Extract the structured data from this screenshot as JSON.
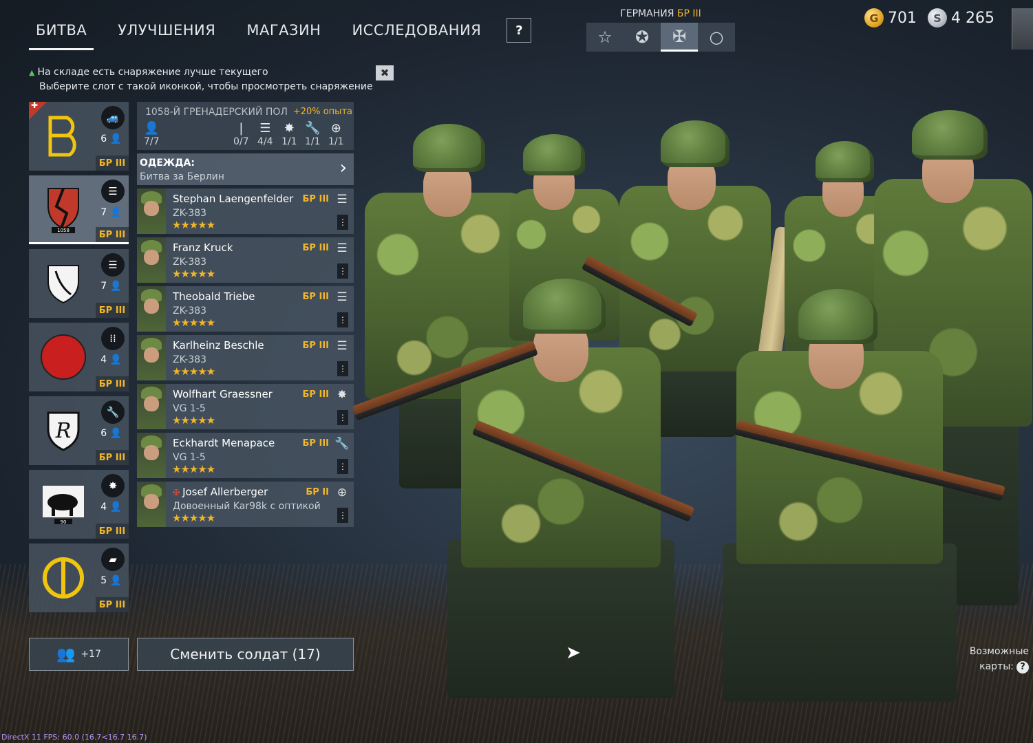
{
  "nav": {
    "tabs": [
      "БИТВА",
      "УЛУЧШЕНИЯ",
      "МАГАЗИН",
      "ИССЛЕДОВАНИЯ"
    ],
    "active_tab": 0,
    "help": "?"
  },
  "nation": {
    "title": "ГЕРМАНИЯ",
    "br": "БР III",
    "tabs": [
      "☆",
      "✪",
      "✠",
      "○"
    ],
    "active": 2
  },
  "currency": {
    "gold": "701",
    "silver": "4 265",
    "gold_icon": "G",
    "silver_icon": "S"
  },
  "notice": {
    "line1": "На складе есть снаряжение лучше текущего",
    "line2": "Выберите слот с такой иконкой, чтобы просмотреть снаряжение",
    "close": "✖"
  },
  "squads": [
    {
      "count": "6",
      "br": "БР III",
      "type_icon": "jeep-icon",
      "emblem": "B"
    },
    {
      "count": "7",
      "br": "БР III",
      "type_icon": "radio-icon",
      "emblem": "1058"
    },
    {
      "count": "7",
      "br": "БР III",
      "type_icon": "radio-icon",
      "emblem": "sword"
    },
    {
      "count": "4",
      "br": "БР III",
      "type_icon": "ammo-icon",
      "emblem": "circle"
    },
    {
      "count": "6",
      "br": "БР III",
      "type_icon": "wrench-icon",
      "emblem": "R"
    },
    {
      "count": "4",
      "br": "БР III",
      "type_icon": "flame-icon",
      "emblem": "90"
    },
    {
      "count": "5",
      "br": "БР III",
      "type_icon": "tank-icon",
      "emblem": "Φ"
    }
  ],
  "unit": {
    "name": "1058-Й ГРЕНАДЕРСКИЙ ПОЛ",
    "xp_bonus": "+20% опыта",
    "slots": [
      {
        "icon": "👤",
        "value": "7/7"
      },
      {
        "icon": "❘",
        "value": "0/7"
      },
      {
        "icon": "☰",
        "value": "4/4"
      },
      {
        "icon": "✸",
        "value": "1/1"
      },
      {
        "icon": "🔧",
        "value": "1/1"
      },
      {
        "icon": "⊕",
        "value": "1/1"
      }
    ],
    "outfit_label": "ОДЕЖДА:",
    "outfit_value": "Битва за Берлин"
  },
  "soldiers": [
    {
      "name": "Stephan Laengenfelder",
      "weapon": "ZK-383",
      "br": "БР III",
      "cls": "☰",
      "stars": "★★★★★"
    },
    {
      "name": "Franz Kruck",
      "weapon": "ZK-383",
      "br": "БР III",
      "cls": "☰",
      "stars": "★★★★★"
    },
    {
      "name": "Theobald Triebe",
      "weapon": "ZK-383",
      "br": "БР III",
      "cls": "☰",
      "stars": "★★★★★"
    },
    {
      "name": "Karlheinz Beschle",
      "weapon": "ZK-383",
      "br": "БР III",
      "cls": "☰",
      "stars": "★★★★★"
    },
    {
      "name": "Wolfhart Graessner",
      "weapon": "VG 1-5",
      "br": "БР III",
      "cls": "✸",
      "stars": "★★★★★"
    },
    {
      "name": "Eckhardt Menapace",
      "weapon": "VG 1-5",
      "br": "БР III",
      "cls": "🔧",
      "stars": "★★★★★"
    },
    {
      "name": "Josef Allerberger",
      "weapon": "Довоенный Kar98k с оптикой",
      "br": "БР II",
      "cls": "⊕",
      "stars": "★★★★★"
    }
  ],
  "buttons": {
    "recruit": "+17",
    "change": "Сменить солдат (17)"
  },
  "maps": {
    "line1": "Возможные",
    "line2": "карты:",
    "q": "?"
  },
  "fps": "DirectX 11 FPS: 60.0 (16.7<16.7 16.7)",
  "colors": {
    "accent": "#f1b62a",
    "up_arrow": "#59c25c"
  }
}
